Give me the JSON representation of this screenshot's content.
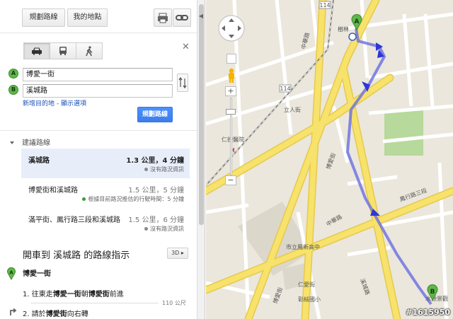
{
  "toolbar": {
    "get_directions": "規劃路線",
    "my_places": "我的地點"
  },
  "route_form": {
    "marker_a": "A",
    "marker_b": "B",
    "origin": "博愛一街",
    "destination": "溪城路",
    "add_destination": "新增目的地",
    "separator": " - ",
    "show_options": "顯示選項",
    "submit": "規劃路線"
  },
  "suggested_routes": {
    "heading": "建議路線",
    "routes": [
      {
        "name": "溪城路",
        "stats": "1.3 公里，4 分鐘",
        "note": "沒有路況資訊",
        "note_color": "#888888",
        "selected": true
      },
      {
        "name": "博愛街和溪城路",
        "stats": "1.5 公里，5 分鐘",
        "note": "根據目前路況推估的行駛時間：5 分鐘",
        "note_color": "#3a9b3a",
        "selected": false
      },
      {
        "name": "滿平街、鳳行路三段和溪城路",
        "stats": "1.5 公里，6 分鐘",
        "note": "沒有路況資訊",
        "note_color": "#888888",
        "selected": false
      }
    ]
  },
  "directions": {
    "title": "開車到 溪城路 的路線指示",
    "view_3d": "3D ▸",
    "start": "博愛一街",
    "step1_prefix": "1. 往東走",
    "step1_road": "博愛一街",
    "step1_mid": "朝",
    "step1_target": "博愛街",
    "step1_suffix": "前進",
    "step1_distance": "110 公尺",
    "step2_prefix": "2. 請於",
    "step2_road": "博愛街",
    "step2_suffix": "向右轉"
  },
  "map": {
    "labels": [
      {
        "text": "114",
        "kind": "shield"
      },
      {
        "text": "114",
        "kind": "shield"
      },
      {
        "text": "中華路"
      },
      {
        "text": "中華路"
      },
      {
        "text": "博愛街"
      },
      {
        "text": "博愛街"
      },
      {
        "text": "鳳行路三段"
      },
      {
        "text": "溪城路"
      },
      {
        "text": "立人街"
      },
      {
        "text": "仁德醫院"
      },
      {
        "text": "市立鳳新高中"
      },
      {
        "text": "樹林"
      },
      {
        "text": "H"
      },
      {
        "text": "仁愛街"
      },
      {
        "text": "彰綏國小"
      },
      {
        "text": "水源景觀"
      }
    ],
    "markers": {
      "a": "A",
      "b": "B"
    },
    "route_color": "#6a6fe0",
    "watermark": "#1615950"
  },
  "colors": {
    "primary_button": "#4d90fe",
    "link": "#1a4fb3",
    "marker_green": "#5fb74a",
    "selected_route_bg": "#e8eef9",
    "road_yellow": "#f7e26b",
    "road_white": "#ffffff",
    "park_green": "#b7d99b"
  }
}
